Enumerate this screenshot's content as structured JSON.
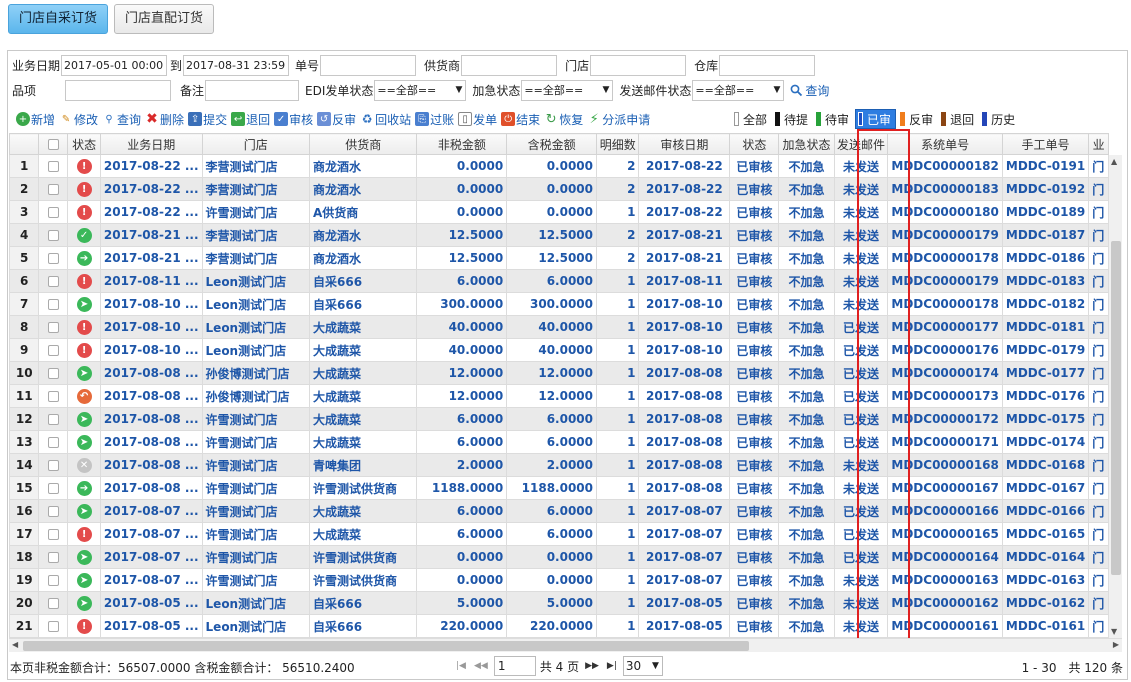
{
  "tabs": [
    {
      "label": "门店自采订货",
      "active": true
    },
    {
      "label": "门店直配订货",
      "active": false
    }
  ],
  "filters": {
    "date_label": "业务日期",
    "date_from": "2017-05-01 00:00",
    "to_label": "到",
    "date_to": "2017-08-31 23:59",
    "order_no_label": "单号",
    "supplier_label": "供货商",
    "store_label": "门店",
    "warehouse_label": "仓库",
    "item_label": "品项",
    "remark_label": "备注",
    "edi_label": "EDI发单状态",
    "edi_value": "==全部==",
    "urgent_label": "加急状态",
    "urgent_value": "==全部==",
    "mail_label": "发送邮件状态",
    "mail_value": "==全部==",
    "search_label": "查询"
  },
  "toolbar": [
    "新增",
    "修改",
    "查询",
    "删除",
    "提交",
    "退回",
    "审核",
    "反审",
    "回收站",
    "过账",
    "发单",
    "结束",
    "恢复",
    "分派申请"
  ],
  "status_filters": [
    {
      "label": "全部",
      "color": "#ffffff",
      "active": false
    },
    {
      "label": "待提",
      "color": "#111111",
      "active": false
    },
    {
      "label": "待审",
      "color": "#27a23a",
      "active": false
    },
    {
      "label": "已审",
      "color": "#1e4fc2",
      "active": true
    },
    {
      "label": "反审",
      "color": "#f07d1c",
      "active": false
    },
    {
      "label": "退回",
      "color": "#8b4513",
      "active": false
    },
    {
      "label": "历史",
      "color": "#2446b8",
      "active": false
    }
  ],
  "columns": [
    "状态",
    "业务日期",
    "门店",
    "供货商",
    "非税金额",
    "含税金额",
    "明细数",
    "审核日期",
    "状态",
    "加急状态",
    "发送邮件",
    "系统单号",
    "手工单号",
    "业"
  ],
  "rows": [
    {
      "n": "1",
      "st": "red",
      "icon": "!",
      "date": "2017-08-22 ...",
      "store": "李营测试门店",
      "supplier": "商龙酒水",
      "net": "0.0000",
      "gross": "0.0000",
      "lines": "2",
      "audit": "2017-08-22",
      "status": "已审核",
      "urgent": "不加急",
      "mail": "未发送",
      "sys": "MDDC00000182",
      "manual": "MDDC-0191",
      "extra": "门"
    },
    {
      "n": "2",
      "st": "red",
      "icon": "!",
      "date": "2017-08-22 ...",
      "store": "李营测试门店",
      "supplier": "商龙酒水",
      "net": "0.0000",
      "gross": "0.0000",
      "lines": "2",
      "audit": "2017-08-22",
      "status": "已审核",
      "urgent": "不加急",
      "mail": "未发送",
      "sys": "MDDC00000183",
      "manual": "MDDC-0192",
      "extra": "门"
    },
    {
      "n": "3",
      "st": "red",
      "icon": "!",
      "date": "2017-08-22 ...",
      "store": "许雪测试门店",
      "supplier": "A供货商",
      "net": "0.0000",
      "gross": "0.0000",
      "lines": "1",
      "audit": "2017-08-22",
      "status": "已审核",
      "urgent": "不加急",
      "mail": "未发送",
      "sys": "MDDC00000180",
      "manual": "MDDC-0189",
      "extra": "门"
    },
    {
      "n": "4",
      "st": "green",
      "icon": "✓",
      "date": "2017-08-21 ...",
      "store": "李营测试门店",
      "supplier": "商龙酒水",
      "net": "12.5000",
      "gross": "12.5000",
      "lines": "2",
      "audit": "2017-08-21",
      "status": "已审核",
      "urgent": "不加急",
      "mail": "未发送",
      "sys": "MDDC00000179",
      "manual": "MDDC-0187",
      "extra": "门"
    },
    {
      "n": "5",
      "st": "green",
      "icon": "➔",
      "date": "2017-08-21 ...",
      "store": "李营测试门店",
      "supplier": "商龙酒水",
      "net": "12.5000",
      "gross": "12.5000",
      "lines": "2",
      "audit": "2017-08-21",
      "status": "已审核",
      "urgent": "不加急",
      "mail": "未发送",
      "sys": "MDDC00000178",
      "manual": "MDDC-0186",
      "extra": "门"
    },
    {
      "n": "6",
      "st": "red",
      "icon": "!",
      "date": "2017-08-11 ...",
      "store": "Leon测试门店",
      "supplier": "自采666",
      "net": "6.0000",
      "gross": "6.0000",
      "lines": "1",
      "audit": "2017-08-11",
      "status": "已审核",
      "urgent": "不加急",
      "mail": "未发送",
      "sys": "MDDC00000179",
      "manual": "MDDC-0183",
      "extra": "门"
    },
    {
      "n": "7",
      "st": "green",
      "icon": "➤",
      "date": "2017-08-10 ...",
      "store": "Leon测试门店",
      "supplier": "自采666",
      "net": "300.0000",
      "gross": "300.0000",
      "lines": "1",
      "audit": "2017-08-10",
      "status": "已审核",
      "urgent": "不加急",
      "mail": "未发送",
      "sys": "MDDC00000178",
      "manual": "MDDC-0182",
      "extra": "门"
    },
    {
      "n": "8",
      "st": "red",
      "icon": "!",
      "date": "2017-08-10 ...",
      "store": "Leon测试门店",
      "supplier": "大成蔬菜",
      "net": "40.0000",
      "gross": "40.0000",
      "lines": "1",
      "audit": "2017-08-10",
      "status": "已审核",
      "urgent": "不加急",
      "mail": "已发送",
      "sys": "MDDC00000177",
      "manual": "MDDC-0181",
      "extra": "门"
    },
    {
      "n": "9",
      "st": "red",
      "icon": "!",
      "date": "2017-08-10 ...",
      "store": "Leon测试门店",
      "supplier": "大成蔬菜",
      "net": "40.0000",
      "gross": "40.0000",
      "lines": "1",
      "audit": "2017-08-10",
      "status": "已审核",
      "urgent": "不加急",
      "mail": "已发送",
      "sys": "MDDC00000176",
      "manual": "MDDC-0179",
      "extra": "门"
    },
    {
      "n": "10",
      "st": "green",
      "icon": "➤",
      "date": "2017-08-08 ...",
      "store": "孙俊博测试门店",
      "supplier": "大成蔬菜",
      "net": "12.0000",
      "gross": "12.0000",
      "lines": "1",
      "audit": "2017-08-08",
      "status": "已审核",
      "urgent": "不加急",
      "mail": "已发送",
      "sys": "MDDC00000174",
      "manual": "MDDC-0177",
      "extra": "门"
    },
    {
      "n": "11",
      "st": "orange",
      "icon": "↶",
      "date": "2017-08-08 ...",
      "store": "孙俊博测试门店",
      "supplier": "大成蔬菜",
      "net": "12.0000",
      "gross": "12.0000",
      "lines": "1",
      "audit": "2017-08-08",
      "status": "已审核",
      "urgent": "不加急",
      "mail": "已发送",
      "sys": "MDDC00000173",
      "manual": "MDDC-0176",
      "extra": "门"
    },
    {
      "n": "12",
      "st": "green",
      "icon": "➤",
      "date": "2017-08-08 ...",
      "store": "许雪测试门店",
      "supplier": "大成蔬菜",
      "net": "6.0000",
      "gross": "6.0000",
      "lines": "1",
      "audit": "2017-08-08",
      "status": "已审核",
      "urgent": "不加急",
      "mail": "已发送",
      "sys": "MDDC00000172",
      "manual": "MDDC-0175",
      "extra": "门"
    },
    {
      "n": "13",
      "st": "green",
      "icon": "➤",
      "date": "2017-08-08 ...",
      "store": "许雪测试门店",
      "supplier": "大成蔬菜",
      "net": "6.0000",
      "gross": "6.0000",
      "lines": "1",
      "audit": "2017-08-08",
      "status": "已审核",
      "urgent": "不加急",
      "mail": "已发送",
      "sys": "MDDC00000171",
      "manual": "MDDC-0174",
      "extra": "门"
    },
    {
      "n": "14",
      "st": "gray",
      "icon": "✕",
      "date": "2017-08-08 ...",
      "store": "许雪测试门店",
      "supplier": "青啤集团",
      "net": "2.0000",
      "gross": "2.0000",
      "lines": "1",
      "audit": "2017-08-08",
      "status": "已审核",
      "urgent": "不加急",
      "mail": "未发送",
      "sys": "MDDC00000168",
      "manual": "MDDC-0168",
      "extra": "门"
    },
    {
      "n": "15",
      "st": "green",
      "icon": "➔",
      "date": "2017-08-08 ...",
      "store": "许雪测试门店",
      "supplier": "许雪测试供货商",
      "net": "1188.0000",
      "gross": "1188.0000",
      "lines": "1",
      "audit": "2017-08-08",
      "status": "已审核",
      "urgent": "不加急",
      "mail": "未发送",
      "sys": "MDDC00000167",
      "manual": "MDDC-0167",
      "extra": "门"
    },
    {
      "n": "16",
      "st": "green",
      "icon": "➤",
      "date": "2017-08-07 ...",
      "store": "许雪测试门店",
      "supplier": "大成蔬菜",
      "net": "6.0000",
      "gross": "6.0000",
      "lines": "1",
      "audit": "2017-08-07",
      "status": "已审核",
      "urgent": "不加急",
      "mail": "已发送",
      "sys": "MDDC00000166",
      "manual": "MDDC-0166",
      "extra": "门"
    },
    {
      "n": "17",
      "st": "red",
      "icon": "!",
      "date": "2017-08-07 ...",
      "store": "许雪测试门店",
      "supplier": "大成蔬菜",
      "net": "6.0000",
      "gross": "6.0000",
      "lines": "1",
      "audit": "2017-08-07",
      "status": "已审核",
      "urgent": "不加急",
      "mail": "已发送",
      "sys": "MDDC00000165",
      "manual": "MDDC-0165",
      "extra": "门"
    },
    {
      "n": "18",
      "st": "green",
      "icon": "➤",
      "date": "2017-08-07 ...",
      "store": "许雪测试门店",
      "supplier": "许雪测试供货商",
      "net": "0.0000",
      "gross": "0.0000",
      "lines": "1",
      "audit": "2017-08-07",
      "status": "已审核",
      "urgent": "不加急",
      "mail": "已发送",
      "sys": "MDDC00000164",
      "manual": "MDDC-0164",
      "extra": "门"
    },
    {
      "n": "19",
      "st": "green",
      "icon": "➤",
      "date": "2017-08-07 ...",
      "store": "许雪测试门店",
      "supplier": "许雪测试供货商",
      "net": "0.0000",
      "gross": "0.0000",
      "lines": "1",
      "audit": "2017-08-07",
      "status": "已审核",
      "urgent": "不加急",
      "mail": "未发送",
      "sys": "MDDC00000163",
      "manual": "MDDC-0163",
      "extra": "门"
    },
    {
      "n": "20",
      "st": "green",
      "icon": "➤",
      "date": "2017-08-05 ...",
      "store": "Leon测试门店",
      "supplier": "自采666",
      "net": "5.0000",
      "gross": "5.0000",
      "lines": "1",
      "audit": "2017-08-05",
      "status": "已审核",
      "urgent": "不加急",
      "mail": "未发送",
      "sys": "MDDC00000162",
      "manual": "MDDC-0162",
      "extra": "门"
    },
    {
      "n": "21",
      "st": "red",
      "icon": "!",
      "date": "2017-08-05 ...",
      "store": "Leon测试门店",
      "supplier": "自采666",
      "net": "220.0000",
      "gross": "220.0000",
      "lines": "1",
      "audit": "2017-08-05",
      "status": "已审核",
      "urgent": "不加急",
      "mail": "未发送",
      "sys": "MDDC00000161",
      "manual": "MDDC-0161",
      "extra": "门"
    }
  ],
  "footer": {
    "totals": "本页非税金额合计：56507.0000 含税金额合计： 56510.2400",
    "page": "1",
    "page_count": "共 4 页",
    "page_size": "30",
    "range": "1 - 30　共 120 条"
  }
}
